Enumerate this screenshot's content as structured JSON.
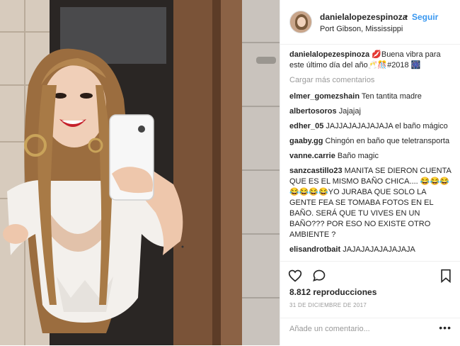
{
  "header": {
    "username": "danielalopezespinoza",
    "separator": "•",
    "follow_label": "Seguir",
    "location": "Port Gibson, Mississippi"
  },
  "caption": {
    "username": "danielalopezespinoza",
    "text": "💋Buena vibra para este último día del año🥂🎊#2018 🎆"
  },
  "load_more_label": "Cargar más comentarios",
  "comments": [
    {
      "user": "elmer_gomezshain",
      "text": "Ten tantita madre"
    },
    {
      "user": "albertosoros",
      "text": "Jajajaj"
    },
    {
      "user": "edher_05",
      "text": "JAJJAJAJAJAJAJA el baño mágico"
    },
    {
      "user": "gaaby.gg",
      "text": "Chingón en baño que teletransporta"
    },
    {
      "user": "vanne.carrie",
      "text": "Baño magic"
    },
    {
      "user": "sanzcastillo23",
      "text": "MANITA SE DIERON CUENTA QUE ES EL MISMO BAÑO CHICA.... 😂😂😂😂😂😂😂YO JURABA QUE SOLO LA GENTE FEA SE TOMABA FOTOS EN EL BAÑO. SERÁ QUE TU VIVES EN UN BAÑO??? POR ESO NO EXISTE OTRO AMBIENTE ?"
    },
    {
      "user": "elisandrotbait",
      "text": "JAJAJAJAJAJAJAJA"
    }
  ],
  "stats": {
    "views": "8.812 reproducciones",
    "date": "31 DE DICIEMBRE DE 2017"
  },
  "comment_box": {
    "placeholder": "Añade un comentario...",
    "more_label": "•••"
  },
  "icons": {
    "like": "heart-icon",
    "comment": "comment-icon",
    "save": "bookmark-icon",
    "more": "ellipsis-icon"
  },
  "colors": {
    "accent": "#3897f0",
    "text": "#262626",
    "muted": "#999999",
    "border": "#efefef"
  }
}
